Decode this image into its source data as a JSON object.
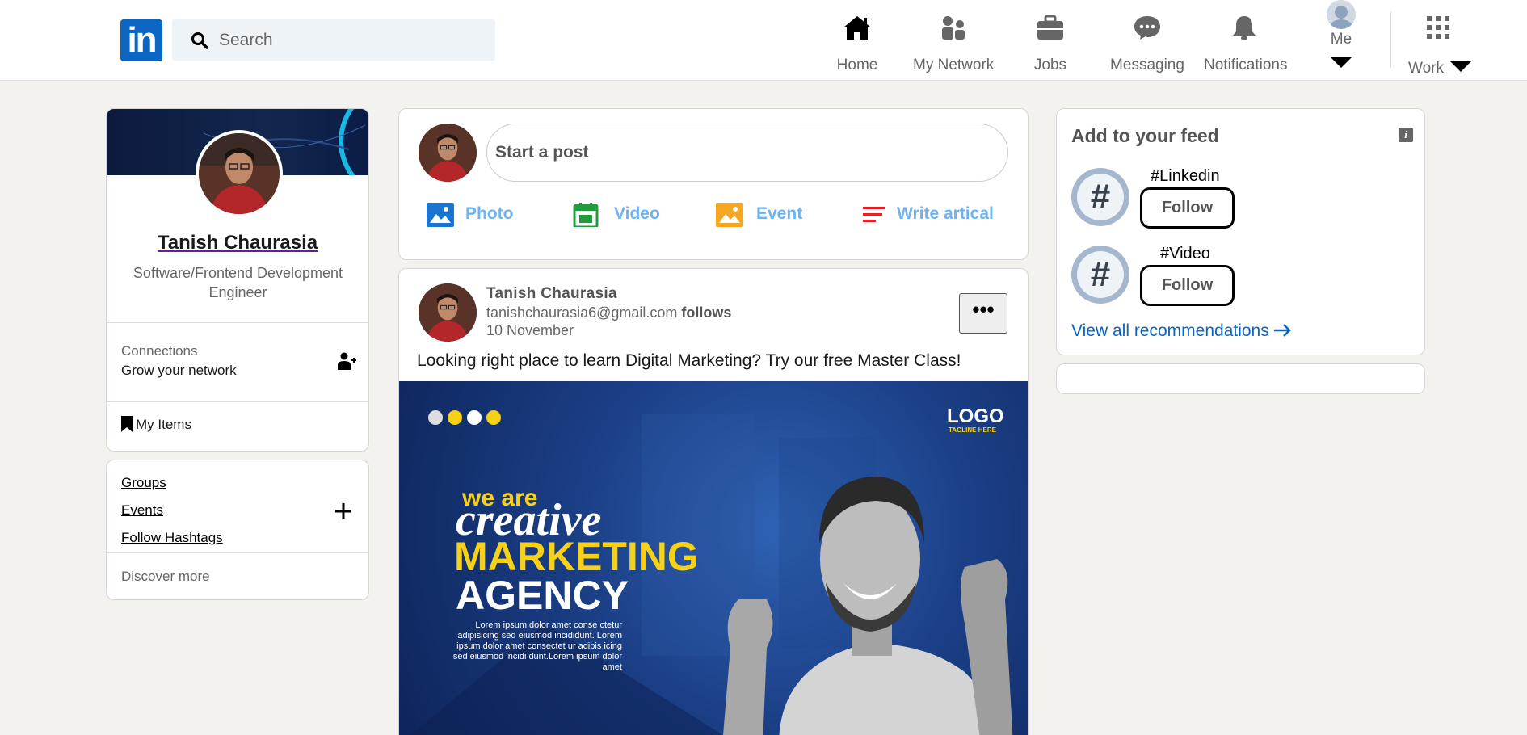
{
  "nav": {
    "logo_text": "in",
    "search_placeholder": "Search",
    "items": [
      {
        "label": "Home",
        "icon": "home-icon"
      },
      {
        "label": "My Network",
        "icon": "network-icon"
      },
      {
        "label": "Jobs",
        "icon": "briefcase-icon"
      },
      {
        "label": "Messaging",
        "icon": "chat-icon"
      },
      {
        "label": "Notifications",
        "icon": "bell-icon"
      },
      {
        "label": "Me",
        "icon": "avatar-icon"
      },
      {
        "label": "Work",
        "icon": "grid-icon"
      }
    ]
  },
  "profile": {
    "name": "Tanish Chaurasia",
    "title": "Software/Frontend Development Engineer",
    "connections_label": "Connections",
    "connections_sub": "Grow your network",
    "my_items": "My Items"
  },
  "shortcuts": {
    "links": [
      "Groups",
      "Events",
      "Follow Hashtags"
    ],
    "discover": "Discover more"
  },
  "composer": {
    "placeholder": "Start a post",
    "actions": [
      {
        "label": "Photo",
        "color": "#1b75d0"
      },
      {
        "label": "Video",
        "color": "#1f9d3a"
      },
      {
        "label": "Event",
        "color": "#f5a623"
      },
      {
        "label": "Write artical",
        "color": "#e02424"
      }
    ]
  },
  "post": {
    "author": "Tanish Chaurasia",
    "email": "tanishchaurasia6@gmail.com",
    "follows": "follows",
    "date": "10 November",
    "more": "•••",
    "text": "Looking right place to learn Digital Marketing? Try our free Master Class!",
    "image": {
      "line1": "we are",
      "line2": "creative",
      "line3": "MARKETING",
      "line4": "AGENCY",
      "logo": "LOGO",
      "tagline": "TAGLINE HERE",
      "lorem": "Lorem ipsum dolor amet conse ctetur adipisicing sed eiusmod incididunt. Lorem ipsum dolor amet consectet ur adipis icing sed eiusmod incidi dunt.Lorem ipsum dolor amet"
    }
  },
  "feed": {
    "title": "Add to your feed",
    "items": [
      {
        "tag": "#Linkedin",
        "button": "Follow"
      },
      {
        "tag": "#Video",
        "button": "Follow"
      }
    ],
    "view_all": "View all recommendations"
  },
  "colors": {
    "brand": "#0a66c2",
    "accent_light": "#6db3f2",
    "promo_yellow": "#f7d117"
  }
}
